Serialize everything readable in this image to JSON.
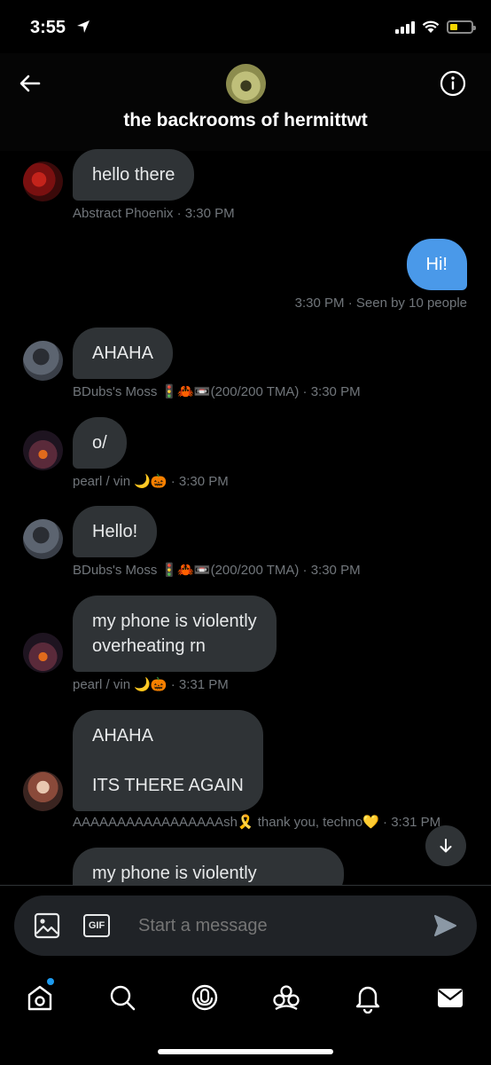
{
  "status_bar": {
    "time": "3:55"
  },
  "header": {
    "title": "the backrooms of hermittwt"
  },
  "messages": [
    {
      "text": "hello there",
      "sender": "Abstract Phoenix",
      "time": "3:30 PM"
    },
    {
      "text": "Hi!",
      "time": "3:30 PM",
      "seen": "Seen by 10 people"
    },
    {
      "text": "AHAHA",
      "sender": "BDubs's Moss 🚦🦀📼(200/200 TMA)",
      "time": "3:30 PM"
    },
    {
      "text": "o/",
      "sender": "pearl / vin 🌙🎃",
      "time": "3:30 PM"
    },
    {
      "text": "Hello!",
      "sender": "BDubs's Moss 🚦🦀📼(200/200 TMA)",
      "time": "3:30 PM"
    },
    {
      "text": "my phone is violently\noverheating rn",
      "sender": "pearl / vin 🌙🎃",
      "time": "3:31 PM"
    },
    {
      "text": "AHAHA\n\nITS THERE AGAIN",
      "sender": "AAAAAAAAAAAAAAAAAsh🎗️ thank you, techno💛",
      "time": "3:31 PM"
    },
    {
      "text": "my phone is violently"
    }
  ],
  "composer": {
    "placeholder": "Start a message",
    "gif_label": "GIF"
  },
  "tabs": [
    "home",
    "search",
    "spaces",
    "communities",
    "notifications",
    "messages"
  ],
  "colors": {
    "my_bubble": "#4a99e9",
    "bubble": "#2f3336",
    "accent": "#1d9bf0"
  }
}
